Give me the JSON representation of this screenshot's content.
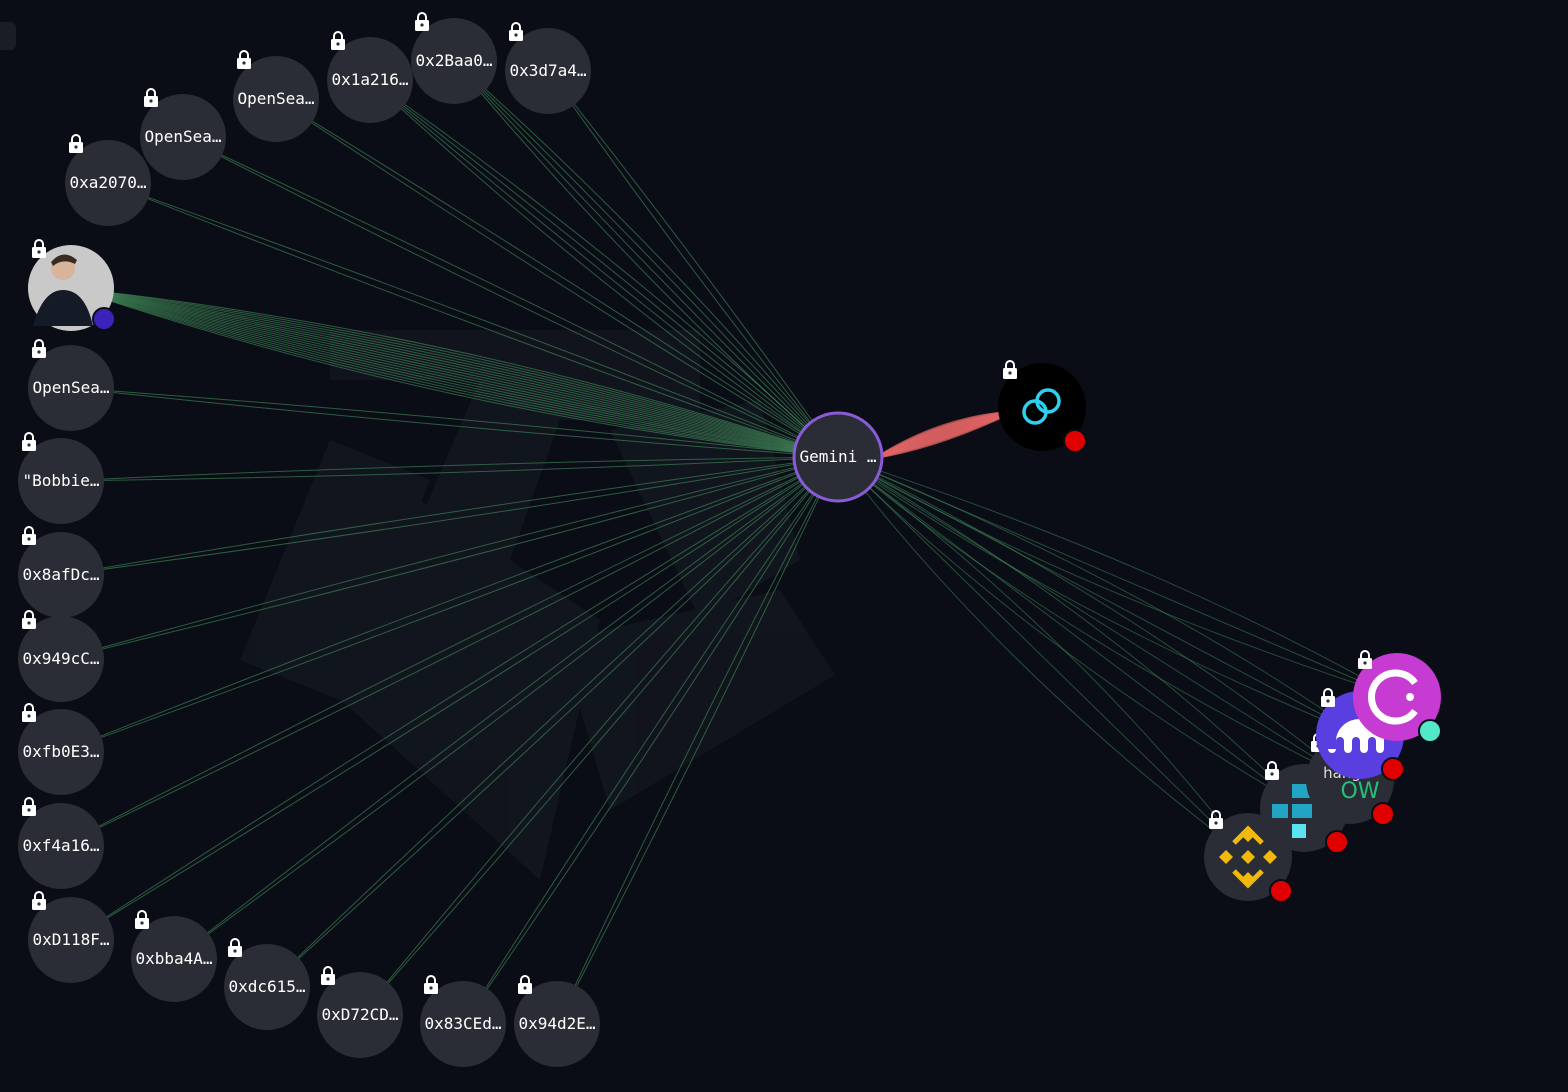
{
  "colors": {
    "background": "#0a0d16",
    "node_fill": "#2b2d36",
    "inflow_edge": "#4a9c63",
    "outflow_edge": "#e06464",
    "center_ring": "#8a5bd6",
    "alert_dot": "#e00000",
    "purple_dot": "#3b22b8",
    "teal_dot": "#53e8c8"
  },
  "center": {
    "label": "Gemini …"
  },
  "left_nodes": [
    {
      "label": "0xa2070…"
    },
    {
      "label": "OpenSea…"
    },
    {
      "label": "OpenSea…"
    },
    {
      "label": "0x1a216…"
    },
    {
      "label": "0x2Baa0…"
    },
    {
      "label": "0x3d7a4…"
    },
    {
      "label": "",
      "icon": "profile-photo"
    },
    {
      "label": "OpenSea…"
    },
    {
      "label": "\"Bobbie…"
    },
    {
      "label": "0x8afDc…"
    },
    {
      "label": "0x949cC…"
    },
    {
      "label": "0xfb0E3…"
    },
    {
      "label": "0xf4a16…"
    },
    {
      "label": "0xD118F…"
    },
    {
      "label": "0xbba4A…"
    },
    {
      "label": "0xdc615…"
    },
    {
      "label": "0xD72CD…"
    },
    {
      "label": "0x83CEd…"
    },
    {
      "label": "0x94d2E…"
    }
  ],
  "right_nodes": [
    {
      "icon": "gemini-logo"
    },
    {
      "icon": "celsius-logo"
    },
    {
      "icon": "kraken-logo"
    },
    {
      "icon": "changenow-logo",
      "partial_text": "OW",
      "partial_text_top": "hang"
    },
    {
      "icon": "ftx-logo"
    },
    {
      "icon": "binance-logo"
    }
  ]
}
